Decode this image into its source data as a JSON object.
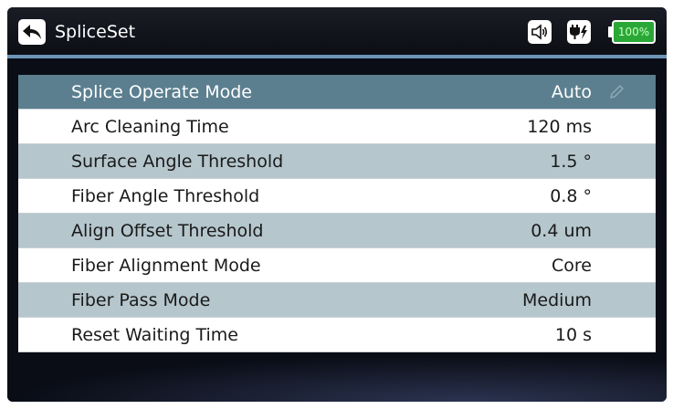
{
  "header": {
    "title": "SpliceSet",
    "battery_label": "100%",
    "icons": [
      "back-arrow-icon",
      "speaker-icon",
      "power-plug-icon",
      "battery-icon"
    ]
  },
  "settings": [
    {
      "label": "Splice Operate Mode",
      "value": "Auto",
      "selected": true
    },
    {
      "label": "Arc Cleaning Time",
      "value": "120 ms"
    },
    {
      "label": "Surface Angle Threshold",
      "value": "1.5 °"
    },
    {
      "label": "Fiber Angle Threshold",
      "value": "0.8 °"
    },
    {
      "label": "Align Offset Threshold",
      "value": "0.4 um"
    },
    {
      "label": "Fiber Alignment Mode",
      "value": "Core"
    },
    {
      "label": "Fiber Pass Mode",
      "value": "Medium"
    },
    {
      "label": "Reset Waiting Time",
      "value": "10 s"
    }
  ],
  "colors": {
    "selected_row": "#5b7f8f",
    "alt_row": "#b5c6cd",
    "header_accent": "#6c93b8",
    "battery_fill": "#2aa837"
  }
}
